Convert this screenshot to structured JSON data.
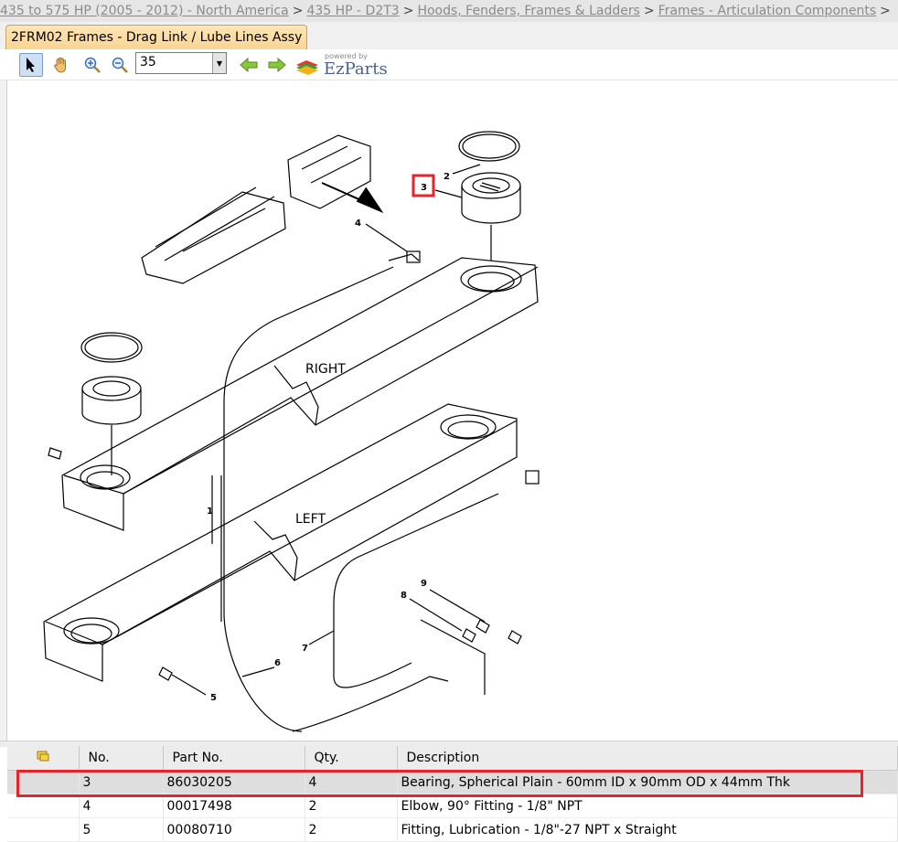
{
  "breadcrumb": {
    "items": [
      "435 to 575 HP (2005 - 2012) - North America",
      "435 HP - D2T3",
      "Hoods, Fenders, Frames & Ladders",
      "Frames - Articulation Components"
    ],
    "separator": ">"
  },
  "tab": {
    "label": "2FRM02 Frames - Drag Link / Lube Lines Assy"
  },
  "toolbar": {
    "zoom_value": "35",
    "logo_powered": "powered by",
    "logo_name": "EzParts"
  },
  "diagram": {
    "labels": {
      "right": "RIGHT",
      "left": "LEFT"
    },
    "callouts": [
      "1",
      "2",
      "3",
      "4",
      "5",
      "6",
      "7",
      "8",
      "9"
    ],
    "selected_callout": "3"
  },
  "parts_table": {
    "headers": [
      "No.",
      "Part No.",
      "Qty.",
      "Description"
    ],
    "rows": [
      {
        "no": "3",
        "part": "86030205",
        "qty": "4",
        "desc": "Bearing, Spherical Plain - 60mm ID x 90mm OD x 44mm Thk"
      },
      {
        "no": "4",
        "part": "00017498",
        "qty": "2",
        "desc": "Elbow, 90° Fitting - 1/8\" NPT"
      },
      {
        "no": "5",
        "part": "00080710",
        "qty": "2",
        "desc": "Fitting, Lubrication - 1/8\"-27 NPT x Straight"
      }
    ]
  },
  "colors": {
    "highlight": "#e8232b",
    "tab_bg": "#fbd492",
    "selected_row": "#dedede"
  }
}
